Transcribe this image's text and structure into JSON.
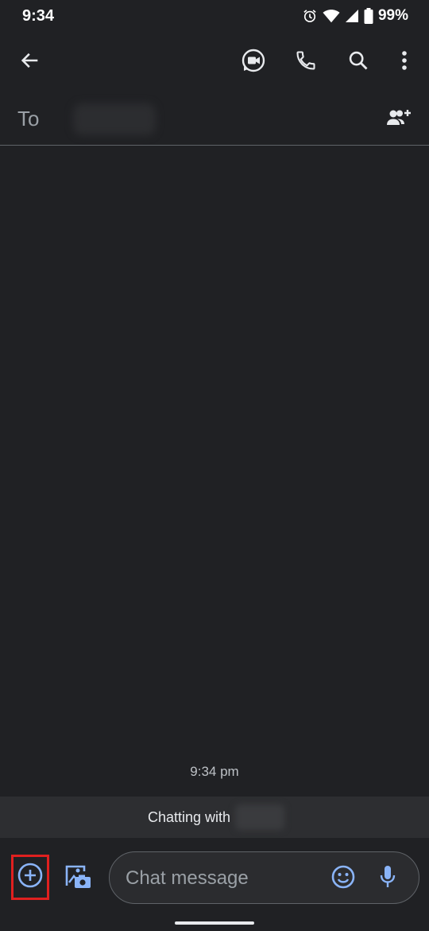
{
  "status_bar": {
    "time": "9:34",
    "battery_percent": "99%",
    "icons": [
      "alarm-icon",
      "wifi-icon",
      "signal-icon",
      "battery-icon"
    ]
  },
  "app_bar": {
    "icons": [
      "back-arrow-icon",
      "video-call-icon",
      "phone-icon",
      "search-icon",
      "more-vert-icon"
    ]
  },
  "recipient": {
    "to_label": "To",
    "add_person_icon": "add-person-icon"
  },
  "conversation": {
    "timestamp": "9:34 pm",
    "banner_text": "Chatting with"
  },
  "compose": {
    "placeholder": "Chat message",
    "value": "",
    "icons": [
      "add-circle-icon",
      "gallery-camera-icon",
      "emoji-icon",
      "mic-icon"
    ]
  },
  "colors": {
    "background": "#202124",
    "accent": "#8ab4f8",
    "highlight": "#e0201f"
  }
}
